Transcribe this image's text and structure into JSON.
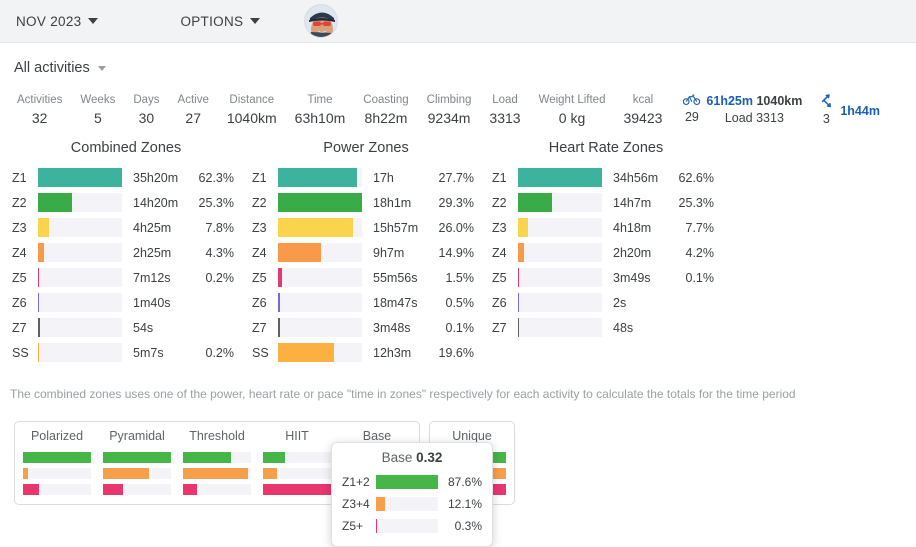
{
  "topbar": {
    "period_label": "NOV 2023",
    "options_label": "OPTIONS",
    "avatar_alt": "user-avatar"
  },
  "filter": {
    "label": "All activities"
  },
  "stats": [
    {
      "label": "Activities",
      "value": "32"
    },
    {
      "label": "Weeks",
      "value": "5"
    },
    {
      "label": "Days",
      "value": "30"
    },
    {
      "label": "Active",
      "value": "27"
    },
    {
      "label": "Distance",
      "value": "1040km"
    },
    {
      "label": "Time",
      "value": "63h10m"
    },
    {
      "label": "Coasting",
      "value": "8h22m"
    },
    {
      "label": "Climbing",
      "value": "9234m"
    },
    {
      "label": "Load",
      "value": "3313"
    },
    {
      "label": "Weight Lifted",
      "value": "0 kg"
    },
    {
      "label": "kcal",
      "value": "39423"
    }
  ],
  "sports": [
    {
      "icon": "bicycle-icon",
      "count": "29",
      "time": "61h25m",
      "distance": "1040km",
      "load": "Load 3313"
    },
    {
      "icon": "strength-icon",
      "count": "3",
      "time": "1h44m"
    }
  ],
  "zone_colors": {
    "z1": "#3db39e",
    "z2": "#3aac47",
    "z3": "#fcd34d",
    "z4": "#f89a4a",
    "z5": "#e03c72",
    "z6": "#7b68d9",
    "z7": "#5f6368",
    "ss": "#fbb040",
    "track": "#f4f4f8",
    "green": "#46b649",
    "orange": "#f89f4c",
    "pink": "#e8366f"
  },
  "zone_tables": [
    {
      "title": "Combined Zones",
      "rows": [
        {
          "name": "Z1",
          "time": "35h20m",
          "pct": "62.3%",
          "bar": 100,
          "color": "#3db39e"
        },
        {
          "name": "Z2",
          "time": "14h20m",
          "pct": "25.3%",
          "bar": 40.6,
          "color": "#3aac47"
        },
        {
          "name": "Z3",
          "time": "4h25m",
          "pct": "7.8%",
          "bar": 12.5,
          "color": "#fcd34d"
        },
        {
          "name": "Z4",
          "time": "2h25m",
          "pct": "4.3%",
          "bar": 6.9,
          "color": "#f89a4a"
        },
        {
          "name": "Z5",
          "time": "7m12s",
          "pct": "0.2%",
          "bar": 1.2,
          "color": "#e03c72"
        },
        {
          "name": "Z6",
          "time": "1m40s",
          "pct": "",
          "bar": 1.2,
          "color": "#7b68d9"
        },
        {
          "name": "Z7",
          "time": "54s",
          "pct": "",
          "bar": 1.6,
          "color": "#5f6368"
        },
        {
          "name": "SS",
          "time": "5m7s",
          "pct": "0.2%",
          "bar": 1.2,
          "color": "#fbb040"
        }
      ]
    },
    {
      "title": "Power Zones",
      "rows": [
        {
          "name": "Z1",
          "time": "17h",
          "pct": "27.7%",
          "bar": 94.5,
          "color": "#3db39e"
        },
        {
          "name": "Z2",
          "time": "18h1m",
          "pct": "29.3%",
          "bar": 100,
          "color": "#3aac47"
        },
        {
          "name": "Z3",
          "time": "15h57m",
          "pct": "26.0%",
          "bar": 88.7,
          "color": "#fcd34d"
        },
        {
          "name": "Z4",
          "time": "9h7m",
          "pct": "14.9%",
          "bar": 50.8,
          "color": "#f89a4a"
        },
        {
          "name": "Z5",
          "time": "55m56s",
          "pct": "1.5%",
          "bar": 5.1,
          "color": "#e03c72"
        },
        {
          "name": "Z6",
          "time": "18m47s",
          "pct": "0.5%",
          "bar": 1.4,
          "color": "#7b68d9"
        },
        {
          "name": "Z7",
          "time": "3m48s",
          "pct": "0.1%",
          "bar": 1.4,
          "color": "#5f6368"
        },
        {
          "name": "SS",
          "time": "12h3m",
          "pct": "19.6%",
          "bar": 66.9,
          "color": "#fbb040"
        }
      ]
    },
    {
      "title": "Heart Rate Zones",
      "rows": [
        {
          "name": "Z1",
          "time": "34h56m",
          "pct": "62.6%",
          "bar": 100,
          "color": "#3db39e"
        },
        {
          "name": "Z2",
          "time": "14h7m",
          "pct": "25.3%",
          "bar": 40.4,
          "color": "#3aac47"
        },
        {
          "name": "Z3",
          "time": "4h18m",
          "pct": "7.7%",
          "bar": 12.3,
          "color": "#fcd34d"
        },
        {
          "name": "Z4",
          "time": "2h20m",
          "pct": "4.2%",
          "bar": 6.7,
          "color": "#f89a4a"
        },
        {
          "name": "Z5",
          "time": "3m49s",
          "pct": "0.1%",
          "bar": 1.2,
          "color": "#e03c72"
        },
        {
          "name": "Z6",
          "time": "2s",
          "pct": "",
          "bar": 0,
          "color": "#7b68d9"
        },
        {
          "name": "Z7",
          "time": "48s",
          "pct": "",
          "bar": 0,
          "color": "#5f6368"
        }
      ]
    }
  ],
  "note": "The combined zones uses one of the power, heart rate or pace \"time in zones\" respectively for each activity to calculate the totals for the time period",
  "distribution_cards": [
    {
      "columns": [
        {
          "title": "Polarized",
          "bars": [
            100,
            8,
            23
          ]
        },
        {
          "title": "Pyramidal",
          "bars": [
            100,
            68,
            30
          ]
        },
        {
          "title": "Threshold",
          "bars": [
            71,
            95,
            20
          ]
        },
        {
          "title": "HIIT",
          "bars": [
            33,
            20,
            100
          ]
        },
        {
          "title": "Base",
          "bars": [
            100,
            14,
            2
          ]
        }
      ]
    },
    {
      "columns": [
        {
          "title": "Unique",
          "bars": [
            100,
            100,
            100
          ]
        }
      ]
    }
  ],
  "tooltip": {
    "title_prefix": "Base",
    "title_value": "0.32",
    "rows": [
      {
        "name": "Z1+2",
        "pct": "87.6%",
        "bar": 100,
        "color": "#46b649"
      },
      {
        "name": "Z3+4",
        "pct": "12.1%",
        "bar": 14,
        "color": "#f89f4c"
      },
      {
        "name": "Z5+",
        "pct": "0.3%",
        "bar": 1.5,
        "color": "#e8366f"
      }
    ]
  }
}
